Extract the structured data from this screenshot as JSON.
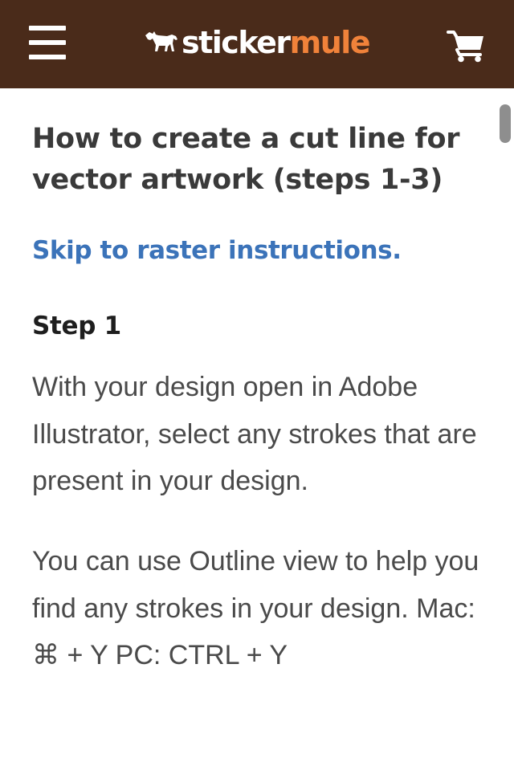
{
  "header": {
    "logo_part1": "sticker",
    "logo_part2": "mule",
    "colors": {
      "background": "#4a2b1a",
      "logo_accent": "#f0823a"
    },
    "icons": [
      "menu-icon",
      "mule-logo-icon",
      "cart-icon"
    ]
  },
  "article": {
    "title": "How to create a cut line for vector artwork (steps 1-3)",
    "skip_link": "Skip to raster instructions.",
    "link_color": "#3b73b9",
    "step_heading": "Step 1",
    "paragraphs": [
      "With your design open in Adobe Illustrator, select any strokes that are present in your design.",
      "You can use Outline view to help you find any strokes in your design. Mac: ⌘ + Y PC: CTRL + Y"
    ]
  }
}
